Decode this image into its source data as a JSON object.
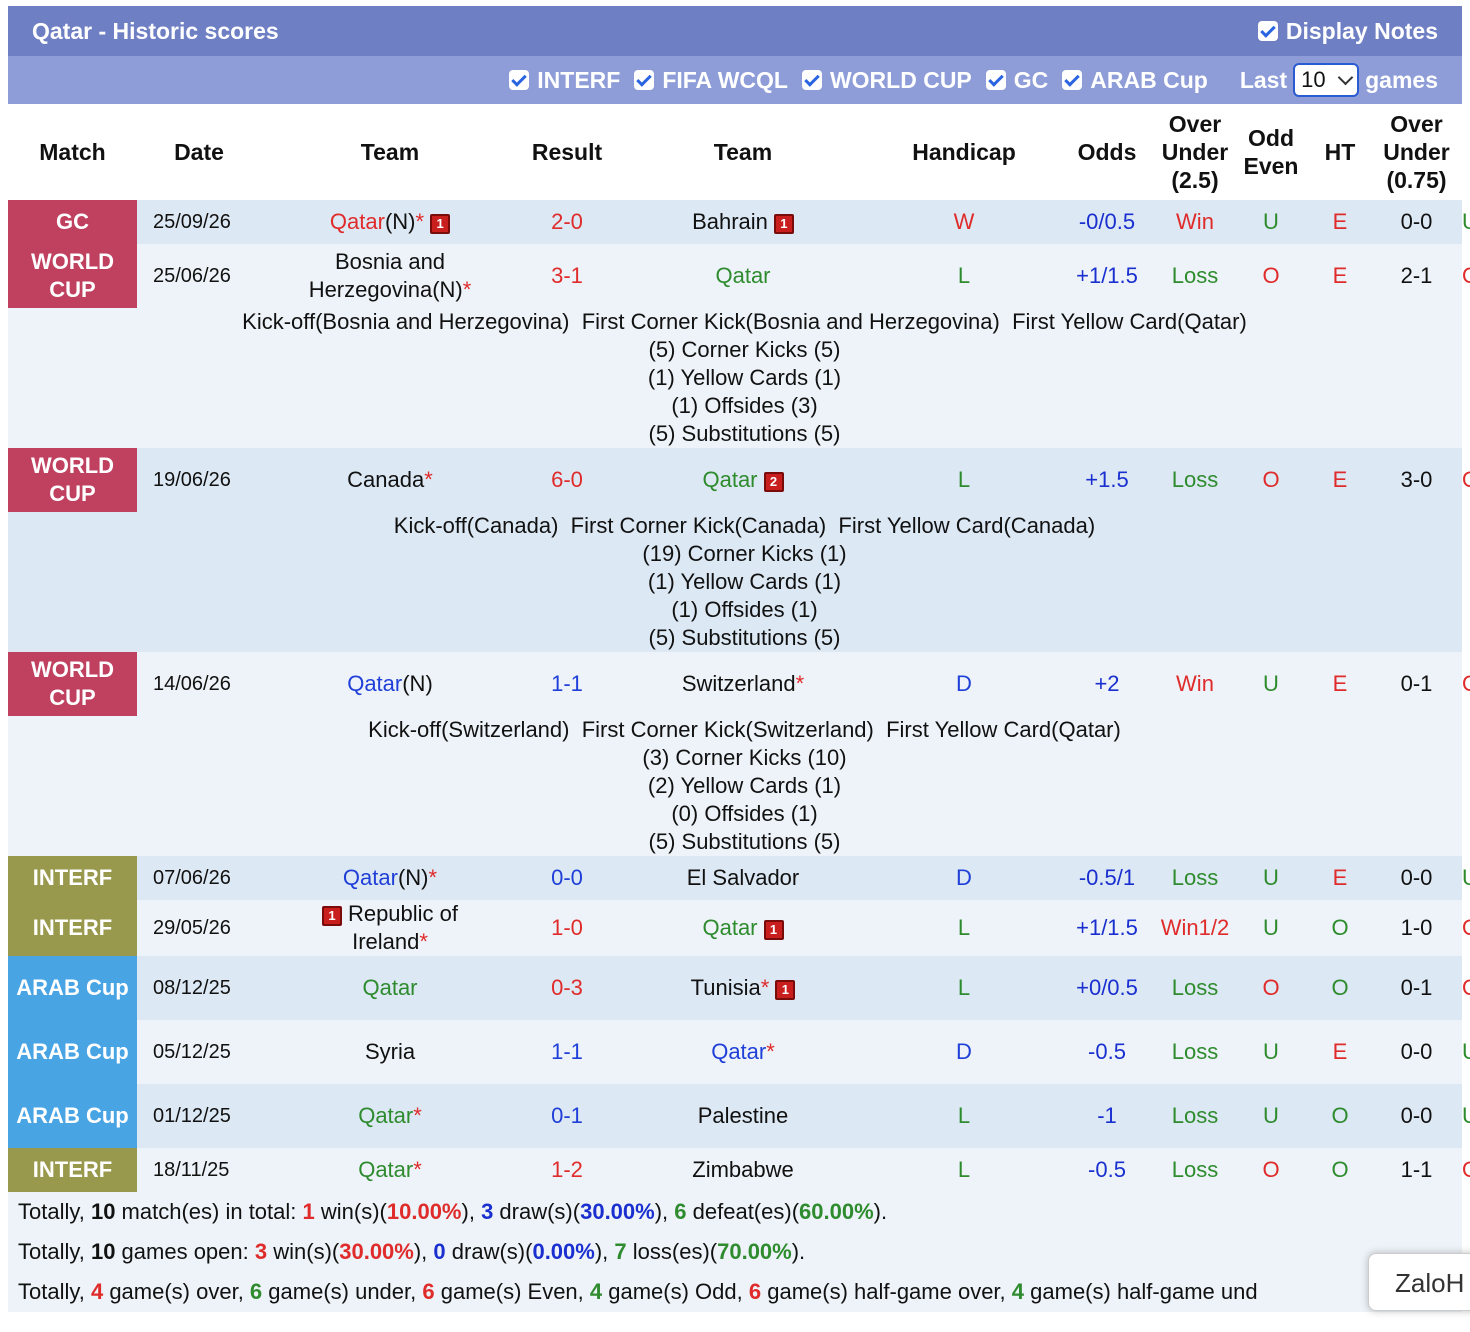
{
  "header": {
    "title": "Qatar - Historic scores",
    "display_notes_label": "Display Notes"
  },
  "filters": {
    "items": [
      "INTERF",
      "FIFA WCQL",
      "WORLD CUP",
      "GC",
      "ARAB Cup"
    ],
    "last_label": "Last",
    "last_value": "10",
    "games_label": "games"
  },
  "columns": [
    "Match",
    "Date",
    "Team",
    "Result",
    "Team",
    "Handicap",
    "Odds",
    "Over Under (2.5)",
    "Odd Even",
    "HT",
    "Over Under (0.75)"
  ],
  "league_colors": {
    "GC": "#c0405f",
    "WORLD CUP": "#c0405f",
    "INTERF": "#99994d",
    "ARAB Cup": "#49a4e3"
  },
  "matches": [
    {
      "league": "GC",
      "date": "25/09/26",
      "home": "Qatar",
      "home_suffix": "(N)",
      "home_star": "*",
      "home_style": "red",
      "home_badge": "1",
      "result_a": "2",
      "result_b": "0",
      "result_style": "red",
      "away": "Bahrain",
      "away_suffix": "",
      "away_star": "",
      "away_style": "black",
      "away_badge": "1",
      "wld": "W",
      "wld_style": "red",
      "handicap": "-0/0.5",
      "odds": "Win",
      "odds_style": "red",
      "ou": "U",
      "oe": "E",
      "ht": "0-0",
      "ou075": "U",
      "notes": null
    },
    {
      "league": "WORLD CUP",
      "date": "25/06/26",
      "home": "Bosnia and Herzegovina",
      "home_suffix": "(N)",
      "home_star": "*",
      "home_style": "black",
      "home_badge": "",
      "result_a": "3",
      "result_b": "1",
      "result_style": "red",
      "away": "Qatar",
      "away_suffix": "",
      "away_star": "",
      "away_style": "green",
      "away_badge": "",
      "wld": "L",
      "wld_style": "green",
      "handicap": "+1/1.5",
      "odds": "Loss",
      "odds_style": "green",
      "ou": "O",
      "oe": "E",
      "ht": "2-1",
      "ou075": "O",
      "notes": {
        "first_line": "Kick-off(Bosnia and Herzegovina)  First Corner Kick(Bosnia and Herzegovina)  First Yellow Card(Qatar)",
        "corner": "(5) Corner Kicks (5)",
        "yellow": "(1) Yellow Cards (1)",
        "offside": "(1) Offsides (3)",
        "subs": "(5) Substitutions (5)"
      }
    },
    {
      "league": "WORLD CUP",
      "date": "19/06/26",
      "home": "Canada",
      "home_suffix": "",
      "home_star": "*",
      "home_style": "black",
      "home_badge": "",
      "result_a": "6",
      "result_b": "0",
      "result_style": "red",
      "away": "Qatar",
      "away_suffix": "",
      "away_star": "",
      "away_style": "green",
      "away_badge": "2",
      "wld": "L",
      "wld_style": "green",
      "handicap": "+1.5",
      "odds": "Loss",
      "odds_style": "green",
      "ou": "O",
      "oe": "E",
      "ht": "3-0",
      "ou075": "O",
      "notes": {
        "first_line": "Kick-off(Canada)  First Corner Kick(Canada)  First Yellow Card(Canada)",
        "corner": "(19) Corner Kicks (1)",
        "yellow": "(1) Yellow Cards (1)",
        "offside": "(1) Offsides (1)",
        "subs": "(5) Substitutions (5)"
      }
    },
    {
      "league": "WORLD CUP",
      "date": "14/06/26",
      "home": "Qatar",
      "home_suffix": "(N)",
      "home_star": "",
      "home_style": "blue",
      "home_badge": "",
      "result_a": "1",
      "result_b": "1",
      "result_style": "blue",
      "away": "Switzerland",
      "away_suffix": "",
      "away_star": "*",
      "away_style": "black",
      "away_badge": "",
      "wld": "D",
      "wld_style": "blue",
      "handicap": "+2",
      "odds": "Win",
      "odds_style": "red",
      "ou": "U",
      "oe": "E",
      "ht": "0-1",
      "ou075": "O",
      "notes": {
        "first_line": "Kick-off(Switzerland)  First Corner Kick(Switzerland)  First Yellow Card(Qatar)",
        "corner": "(3) Corner Kicks (10)",
        "yellow": "(2) Yellow Cards (1)",
        "offside": "(0) Offsides (1)",
        "subs": "(5) Substitutions (5)"
      }
    },
    {
      "league": "INTERF",
      "date": "07/06/26",
      "home": "Qatar",
      "home_suffix": "(N)",
      "home_star": "*",
      "home_style": "blue",
      "home_badge": "",
      "result_a": "0",
      "result_b": "0",
      "result_style": "blue",
      "away": "El Salvador",
      "away_suffix": "",
      "away_star": "",
      "away_style": "black",
      "away_badge": "",
      "wld": "D",
      "wld_style": "blue",
      "handicap": "-0.5/1",
      "odds": "Loss",
      "odds_style": "green",
      "ou": "U",
      "oe": "E",
      "ht": "0-0",
      "ou075": "U",
      "notes": null
    },
    {
      "league": "INTERF",
      "date": "29/05/26",
      "home": "Republic of Ireland",
      "home_suffix": "",
      "home_star": "*",
      "home_style": "black",
      "home_badge": "1",
      "home_badge_left": true,
      "result_a": "1",
      "result_b": "0",
      "result_style": "red",
      "away": "Qatar",
      "away_suffix": "",
      "away_star": "",
      "away_style": "green",
      "away_badge": "1",
      "wld": "L",
      "wld_style": "green",
      "handicap": "+1/1.5",
      "odds": "Win1/2",
      "odds_style": "red",
      "ou": "U",
      "oe": "O",
      "ht": "1-0",
      "ou075": "O",
      "notes": null
    },
    {
      "league": "ARAB Cup",
      "date": "08/12/25",
      "home": "Qatar",
      "home_suffix": "",
      "home_star": "",
      "home_style": "green",
      "home_badge": "",
      "result_a": "0",
      "result_b": "3",
      "result_style": "red",
      "away": "Tunisia",
      "away_suffix": "",
      "away_star": "*",
      "away_style": "black",
      "away_badge": "1",
      "wld": "L",
      "wld_style": "green",
      "handicap": "+0/0.5",
      "odds": "Loss",
      "odds_style": "green",
      "ou": "O",
      "oe": "O",
      "ht": "0-1",
      "ou075": "O",
      "notes": null
    },
    {
      "league": "ARAB Cup",
      "date": "05/12/25",
      "home": "Syria",
      "home_suffix": "",
      "home_star": "",
      "home_style": "black",
      "home_badge": "",
      "result_a": "1",
      "result_b": "1",
      "result_style": "blue",
      "away": "Qatar",
      "away_suffix": "",
      "away_star": "*",
      "away_style": "blue",
      "away_badge": "",
      "wld": "D",
      "wld_style": "blue",
      "handicap": "-0.5",
      "odds": "Loss",
      "odds_style": "green",
      "ou": "U",
      "oe": "E",
      "ht": "0-0",
      "ou075": "U",
      "notes": null
    },
    {
      "league": "ARAB Cup",
      "date": "01/12/25",
      "home": "Qatar",
      "home_suffix": "",
      "home_star": "*",
      "home_style": "green",
      "home_badge": "",
      "result_a": "0",
      "result_b": "1",
      "result_style": "blue",
      "away": "Palestine",
      "away_suffix": "",
      "away_star": "",
      "away_style": "black",
      "away_badge": "",
      "wld": "L",
      "wld_style": "green",
      "handicap": "-1",
      "odds": "Loss",
      "odds_style": "green",
      "ou": "U",
      "oe": "O",
      "ht": "0-0",
      "ou075": "U",
      "notes": null
    },
    {
      "league": "INTERF",
      "date": "18/11/25",
      "home": "Qatar",
      "home_suffix": "",
      "home_star": "*",
      "home_style": "green",
      "home_badge": "",
      "result_a": "1",
      "result_b": "2",
      "result_style": "red",
      "away": "Zimbabwe",
      "away_suffix": "",
      "away_star": "",
      "away_style": "black",
      "away_badge": "",
      "wld": "L",
      "wld_style": "green",
      "handicap": "-0.5",
      "odds": "Loss",
      "odds_style": "green",
      "ou": "O",
      "oe": "O",
      "ht": "1-1",
      "ou075": "O",
      "notes": null
    }
  ],
  "summary": {
    "line1": {
      "p1": "Totally, ",
      "total": "10",
      "p2": " match(es) in total: ",
      "wins": "1",
      "p3": " win(s)(",
      "win_pct": "10.00%",
      "p4": "), ",
      "draws": "3",
      "p5": " draw(s)(",
      "draw_pct": "30.00%",
      "p6": "), ",
      "defeats": "6",
      "p7": " defeat(es)(",
      "defeat_pct": "60.00%",
      "p8": ")."
    },
    "line2": {
      "p1": "Totally, ",
      "total": "10",
      "p2": " games open: ",
      "wins": "3",
      "p3": " win(s)(",
      "win_pct": "30.00%",
      "p4": "), ",
      "draws": "0",
      "p5": " draw(s)(",
      "draw_pct": "0.00%",
      "p6": "), ",
      "losses": "7",
      "p7": " loss(es)(",
      "loss_pct": "70.00%",
      "p8": ")."
    },
    "line3": {
      "p1": "Totally, ",
      "over": "4",
      "p2": " game(s) over, ",
      "under": "6",
      "p3": " game(s) under, ",
      "even": "6",
      "p4": " game(s) Even, ",
      "odd": "4",
      "p5": " game(s) Odd, ",
      "hg_over": "6",
      "p6": " game(s) half-game over, ",
      "hg_under": "4",
      "p7": " game(s) half-game und"
    }
  },
  "zalo_label": "ZaloH"
}
